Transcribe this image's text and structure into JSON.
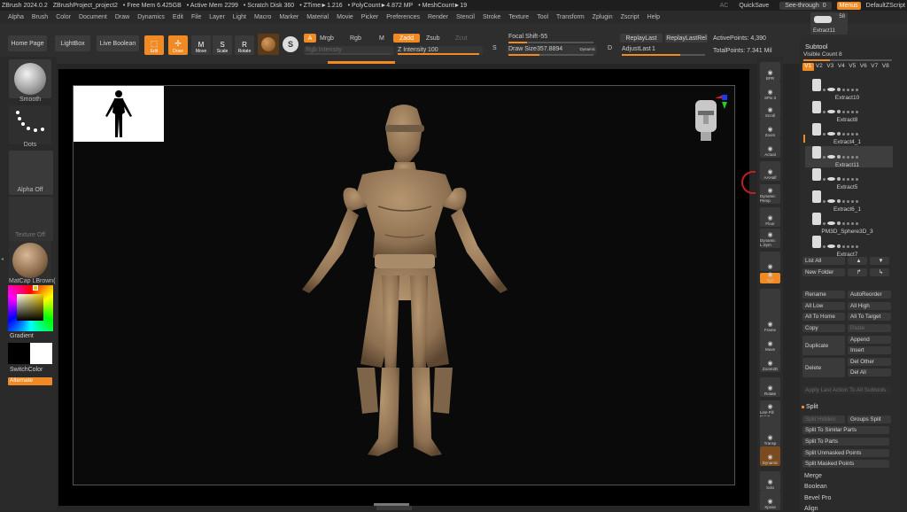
{
  "title_bar": {
    "app": "ZBrush 2024.0.2",
    "project": "ZBrushProject_project2",
    "free_mem": "• Free Mem 6.425GB",
    "active_mem": "• Active Mem 2299",
    "scratch": "• Scratch Disk 360",
    "ztime": "• ZTime►1.216",
    "polycount": "• PolyCount►4.872 MP",
    "meshcount": "• MeshCount►19",
    "ac": "AC",
    "quicksave": "QuickSave",
    "see_through": "See-through",
    "see_through_value": "0",
    "menus": "Menus",
    "zscript": "DefaultZScript"
  },
  "menu_items": [
    "Alpha",
    "Brush",
    "Color",
    "Document",
    "Draw",
    "Dynamics",
    "Edit",
    "File",
    "Layer",
    "Light",
    "Macro",
    "Marker",
    "Material",
    "Movie",
    "Picker",
    "Preferences",
    "Render",
    "Stencil",
    "Stroke",
    "Texture",
    "Tool",
    "Transform",
    "Zplugin",
    "Zscript",
    "Help"
  ],
  "toolbar": {
    "home": "Home Page",
    "lightbox": "LightBox",
    "live_boolean": "Live Boolean",
    "edit": "Edit",
    "draw": "Draw",
    "move": "Move",
    "scale": "Scale",
    "rotate": "Rotate",
    "a": "A",
    "mrgb": "Mrgb",
    "rgb": "Rgb",
    "m": "M",
    "zadd": "Zadd",
    "zsub": "Zsub",
    "zcut": "Zcut",
    "rgb_intensity": "Rgb Intensity",
    "z_intensity_label": "Z Intensity",
    "z_intensity": "100",
    "focal_shift_label": "Focal Shift",
    "focal_shift": "-55",
    "draw_size_label": "Draw Size",
    "draw_size": "357.8894",
    "dynamic": "Dynamic",
    "s": "S",
    "d": "D",
    "replay_last": "ReplayLast",
    "replay_last_rel": "ReplayLastRel",
    "adjust_last_label": "AdjustLast",
    "adjust_last": "1",
    "active_points_label": "ActivePoints:",
    "active_points": "4,390",
    "total_points_label": "TotalPoints:",
    "total_points": "7.341 Mil"
  },
  "left_shelf": {
    "smooth": "Smooth",
    "dots": "Dots",
    "alpha_off": "Alpha Off",
    "texture_off": "Texture Off",
    "matcap": "MatCap LBrown(",
    "gradient": "Gradient",
    "switch_color": "SwitchColor",
    "alternate": "Alternate"
  },
  "right_shelf": [
    "BPR",
    "SPix 3",
    "Scroll",
    "Zoom",
    "Actual",
    "AAHalf",
    "Dynamic Persp",
    "Floor",
    "Dynamic L.Sym",
    "",
    "Xyz",
    "",
    "",
    "Frame",
    "Move",
    "Zoom3D",
    "Rotate",
    "Line Fill PolyF",
    "",
    "Transp",
    "Dynamic",
    "Solo",
    "Xpose"
  ],
  "subtool_panel": {
    "top_thumb_count": "58",
    "top_thumb_label": "Extract11",
    "header": "Subtool",
    "visible_count": "Visible Count 8",
    "versions": [
      "V1",
      "V2",
      "V3",
      "V4",
      "V5",
      "V6",
      "V7",
      "V8"
    ],
    "items": [
      "Extract10",
      "Extract8",
      "Extract4_1",
      "Extract11",
      "Extract5",
      "Extract6_1",
      "PM3D_Sphere3D_3",
      "Extract7"
    ],
    "list_all": "List All",
    "new_folder": "New Folder",
    "rename": "Rename",
    "auto_reorder": "AutoReorder",
    "all_low": "All Low",
    "all_high": "All High",
    "all_to_home": "All To Home",
    "all_to_target": "All To Target",
    "copy": "Copy",
    "paste": "Paste",
    "duplicate": "Duplicate",
    "append": "Append",
    "insert": "Insert",
    "delete": "Delete",
    "del_other": "Del Other",
    "del_all": "Del All",
    "apply_last": "Apply Last Action To All Subtools",
    "split_header": "Split",
    "split_hidden": "Split Hidden",
    "groups_split": "Groups Split",
    "split_similar": "Split To Similar Parts",
    "split_parts": "Split To Parts",
    "split_unmasked": "Split Unmasked Points",
    "split_masked": "Split Masked Points",
    "merge": "Merge",
    "boolean": "Boolean",
    "bevel_pro": "Bevel Pro",
    "align": "Align"
  },
  "colors": {
    "accent": "#f08a24",
    "figure": "#a8875f",
    "background": "#262626"
  }
}
